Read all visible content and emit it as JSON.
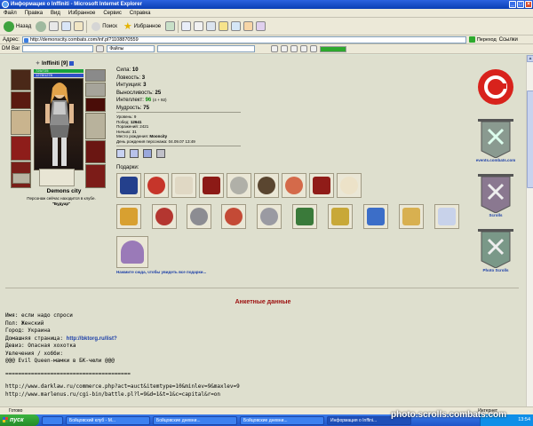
{
  "window": {
    "title": "Информация о Inffiniti - Microsoft Internet Explorer"
  },
  "menu": [
    "Файл",
    "Правка",
    "Вид",
    "Избранное",
    "Сервис",
    "Справка"
  ],
  "toolbar": {
    "back": "Назад",
    "search": "Поиск",
    "favorites": "Избранное"
  },
  "address": {
    "label": "Адрес:",
    "url": "http://demonscity.combats.com/inf.pl?1108870559",
    "go": "Переход",
    "links": "Ссылки"
  },
  "linksbar": {
    "label": "DM Bar",
    "files": "Файлы"
  },
  "character": {
    "name": "Inffiniti",
    "level": "[9]",
    "hp": "725/725",
    "mp": "1278/1278",
    "city": "Demons city",
    "status": "Персонаж сейчас находится в клубе.",
    "location": "\"Будуар\""
  },
  "stats": {
    "strength": {
      "label": "Сила:",
      "value": "10"
    },
    "agility": {
      "label": "Ловкость:",
      "value": "3"
    },
    "intuition": {
      "label": "Интуиция:",
      "value": "3"
    },
    "endurance": {
      "label": "Выносливость:",
      "value": "25"
    },
    "intellect": {
      "label": "Интеллект:",
      "value": "96",
      "bonus": "(4 + 92)"
    },
    "wisdom": {
      "label": "Мудрость:",
      "value": "75"
    }
  },
  "info": {
    "level": "Уровень: 9",
    "wins_label": "Побед:",
    "wins": "12641",
    "losses": "Поражений: 2421",
    "draws": "Ничьих: 31",
    "birthplace_label": "Место рождения:",
    "birthplace": "Mooncity",
    "birthday_label": "День рождения персонажа:",
    "birthday": "04.09.07 13:49"
  },
  "gifts": {
    "label": "Подарки:",
    "all_link": "Нажмите сюда, чтобы увидеть все подарки..."
  },
  "banners": {
    "events": "events.combats.com",
    "scrolls": "Scrolls",
    "photo": "Photo Scrolls"
  },
  "profile": {
    "title": "Анкетные данные",
    "name": "Имя: если надо спроси",
    "gender": "Пол: Женский",
    "city": "Город: Украина",
    "homepage_label": "Домашняя страница:",
    "homepage": "http://bktorg.ru/list?",
    "motto": "Девиз: Опасная хохотка",
    "hobby_label": "Увлечения / хобби:",
    "hobby": "@@@   Evil Queen-мамки в БК-чюли   @@@",
    "separator": "=======================================",
    "link1": "http://www.darklaw.ru/commerce.php?act=auct&itemtype=10&minlev=9&maxlev=9",
    "link2": "http://www.marlenus.ru/cgi-bin/battle.pl?l=9&d=1&t=1&c=capital&r=on"
  },
  "statusbar": {
    "text": "Готово",
    "zone": "Интернет"
  },
  "taskbar": {
    "start": "пуск",
    "tasks": [
      "Бойцовский клуб - M...",
      "Бойцовские дневни...",
      "Бойцовские дневни...",
      "Информация о Inffini..."
    ],
    "time": "13:54"
  },
  "watermark": "photo.scrolls.combats.com",
  "colors": {
    "accent_red": "#9b0c0c",
    "link_blue": "#1b3ea8",
    "hp_green": "#18a33c",
    "mp_blue": "#2f4fc6"
  }
}
